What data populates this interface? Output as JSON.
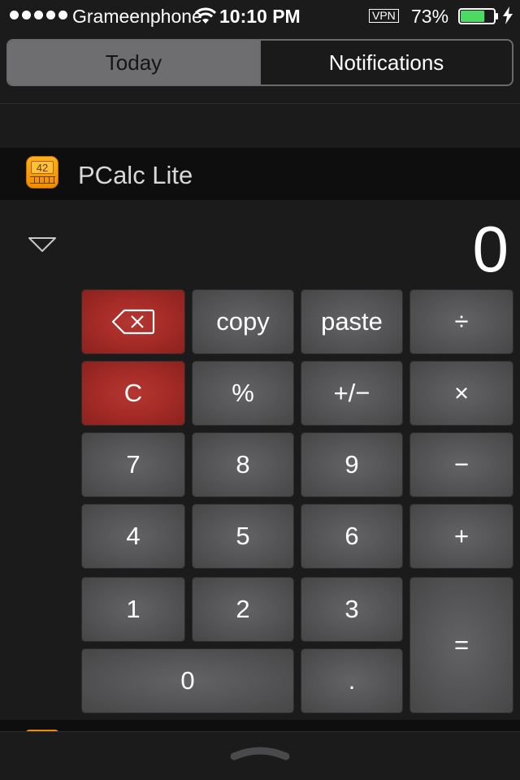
{
  "status_bar": {
    "carrier": "Grameenphone",
    "time": "10:10 PM",
    "vpn": "VPN",
    "battery": "73%",
    "battery_level": 0.73,
    "signal_dots": 5
  },
  "tabs": {
    "today": "Today",
    "notifications": "Notifications",
    "selected": "today"
  },
  "widget": {
    "title": "PCalc Lite",
    "icon_number": "42",
    "display_value": "0"
  },
  "keypad": {
    "copy": "copy",
    "paste": "paste",
    "divide": "÷",
    "clear": "C",
    "percent": "%",
    "plus_minus": "+/−",
    "multiply": "×",
    "seven": "7",
    "eight": "8",
    "nine": "9",
    "minus": "−",
    "four": "4",
    "five": "5",
    "six": "6",
    "plus": "+",
    "one": "1",
    "two": "2",
    "three": "3",
    "equals": "=",
    "zero": "0",
    "decimal": "."
  },
  "colors": {
    "background": "#1b1b1c",
    "key": "#565658",
    "key_red": "#a52b27",
    "battery_green": "#4cd964",
    "icon_orange": "#f5a00a"
  },
  "icons": {
    "wifi": "wifi-icon",
    "battery": "battery-icon",
    "charging": "charging-bolt-icon",
    "backspace": "backspace-icon",
    "collapse": "collapse-triangle-icon",
    "grabber": "pull-up-grabber-icon"
  }
}
